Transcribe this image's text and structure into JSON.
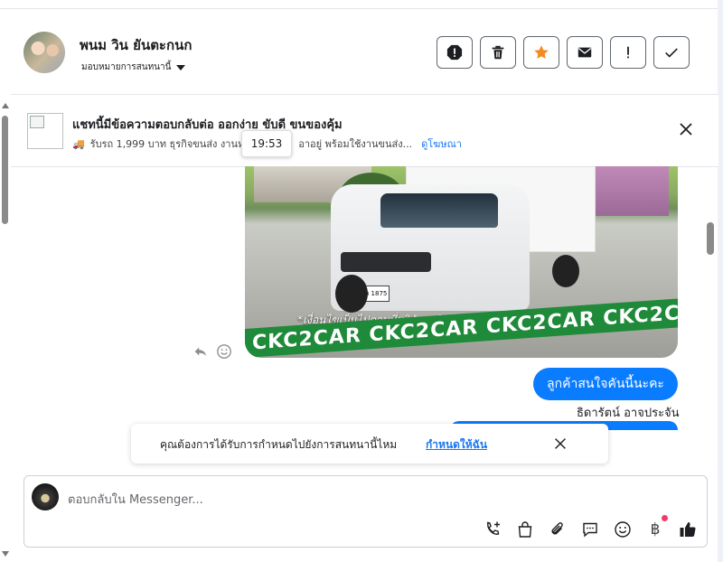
{
  "header": {
    "contact_name": "พนม วิน ยันตะกนก",
    "assign_label": "มอบหมายการสนทนานี้",
    "actions": [
      {
        "name": "report-icon"
      },
      {
        "name": "trash-icon"
      },
      {
        "name": "star-icon",
        "color": "#f28b22"
      },
      {
        "name": "mail-icon"
      },
      {
        "name": "exclamation-icon"
      },
      {
        "name": "check-icon"
      }
    ]
  },
  "ad": {
    "title": "แชทนี้มีข้อความตอบกลับต่อ ออกง่าย ขับดี ขนของคุ้ม",
    "subtitle": "รับรถ 1,999 บาท ธุรกิจขนส่ง งานห",
    "subtitle_tail": "อาอยู่ พร้อมใช้งานขนส่ง...",
    "view_ad": "ดูโฆษณา"
  },
  "tooltip": {
    "time": "19:53"
  },
  "photo": {
    "plate": "ผห 1875",
    "notice": "*เงื่อนไขเป็นไปตามที่บริษัทฯ กำหนด โทรสอบถามเพิ่มเติมได้ที่ 088-5577932",
    "band": "CKC2CAR CKC2CAR CKC2CAR CKC2CAR CKC2"
  },
  "messages": [
    {
      "text": "ลูกค้าสนใจคันนี้นะคะ",
      "sender": "ธิดารัตน์ อาจประจัน"
    }
  ],
  "assign_prompt": {
    "question": "คุณต้องการได้รับการกำหนดไปยังการสนทนานี้ไหม",
    "link": "กำหนดให้ฉัน"
  },
  "composer": {
    "placeholder": "ตอบกลับใน Messenger...",
    "baht_symbol": "฿"
  },
  "colors": {
    "accent": "#0a7cff",
    "link": "#1877f2",
    "notification": "#f03c64"
  }
}
